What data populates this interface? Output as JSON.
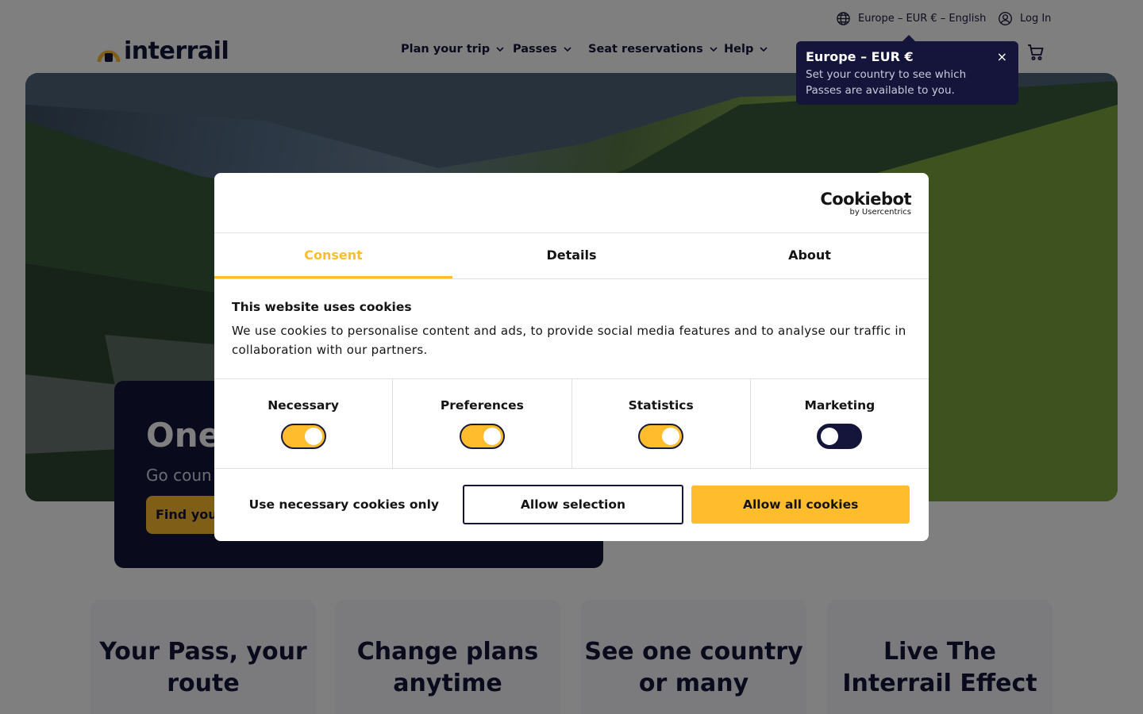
{
  "topbar": {
    "region": "Europe – EUR € – English",
    "login": "Log In"
  },
  "brand": {
    "logo": "interrail"
  },
  "nav": {
    "items": [
      {
        "label": "Plan your trip"
      },
      {
        "label": "Passes"
      },
      {
        "label": "Seat reservations"
      },
      {
        "label": "Help"
      }
    ]
  },
  "tooltip": {
    "title": "Europe – EUR €",
    "text": "Set your country to see which Passes are available to you.",
    "close": "×"
  },
  "hero": {
    "title": "One",
    "subtitle": "Go coun",
    "cta": "Find your"
  },
  "features": [
    {
      "title": "Your Pass, your route"
    },
    {
      "title": "Change plans anytime"
    },
    {
      "title": "See one country or many"
    },
    {
      "title": "Live The Interrail Effect"
    }
  ],
  "cookie": {
    "brand": "Cookiebot",
    "brand_sub": "by Usercentrics",
    "tabs": [
      "Consent",
      "Details",
      "About"
    ],
    "heading": "This website uses cookies",
    "body": "We use cookies to personalise content and ads, to provide social media features and to analyse our traffic in collaboration with our partners.",
    "toggles": [
      {
        "label": "Necessary",
        "state": "on"
      },
      {
        "label": "Preferences",
        "state": "on"
      },
      {
        "label": "Statistics",
        "state": "on"
      },
      {
        "label": "Marketing",
        "state": "off"
      }
    ],
    "buttons": {
      "necessary_only": "Use necessary cookies only",
      "allow_selection": "Allow selection",
      "allow_all": "Allow all cookies"
    }
  },
  "colors": {
    "brand_yellow": "#ffbd2e",
    "brand_navy": "#15153b"
  }
}
